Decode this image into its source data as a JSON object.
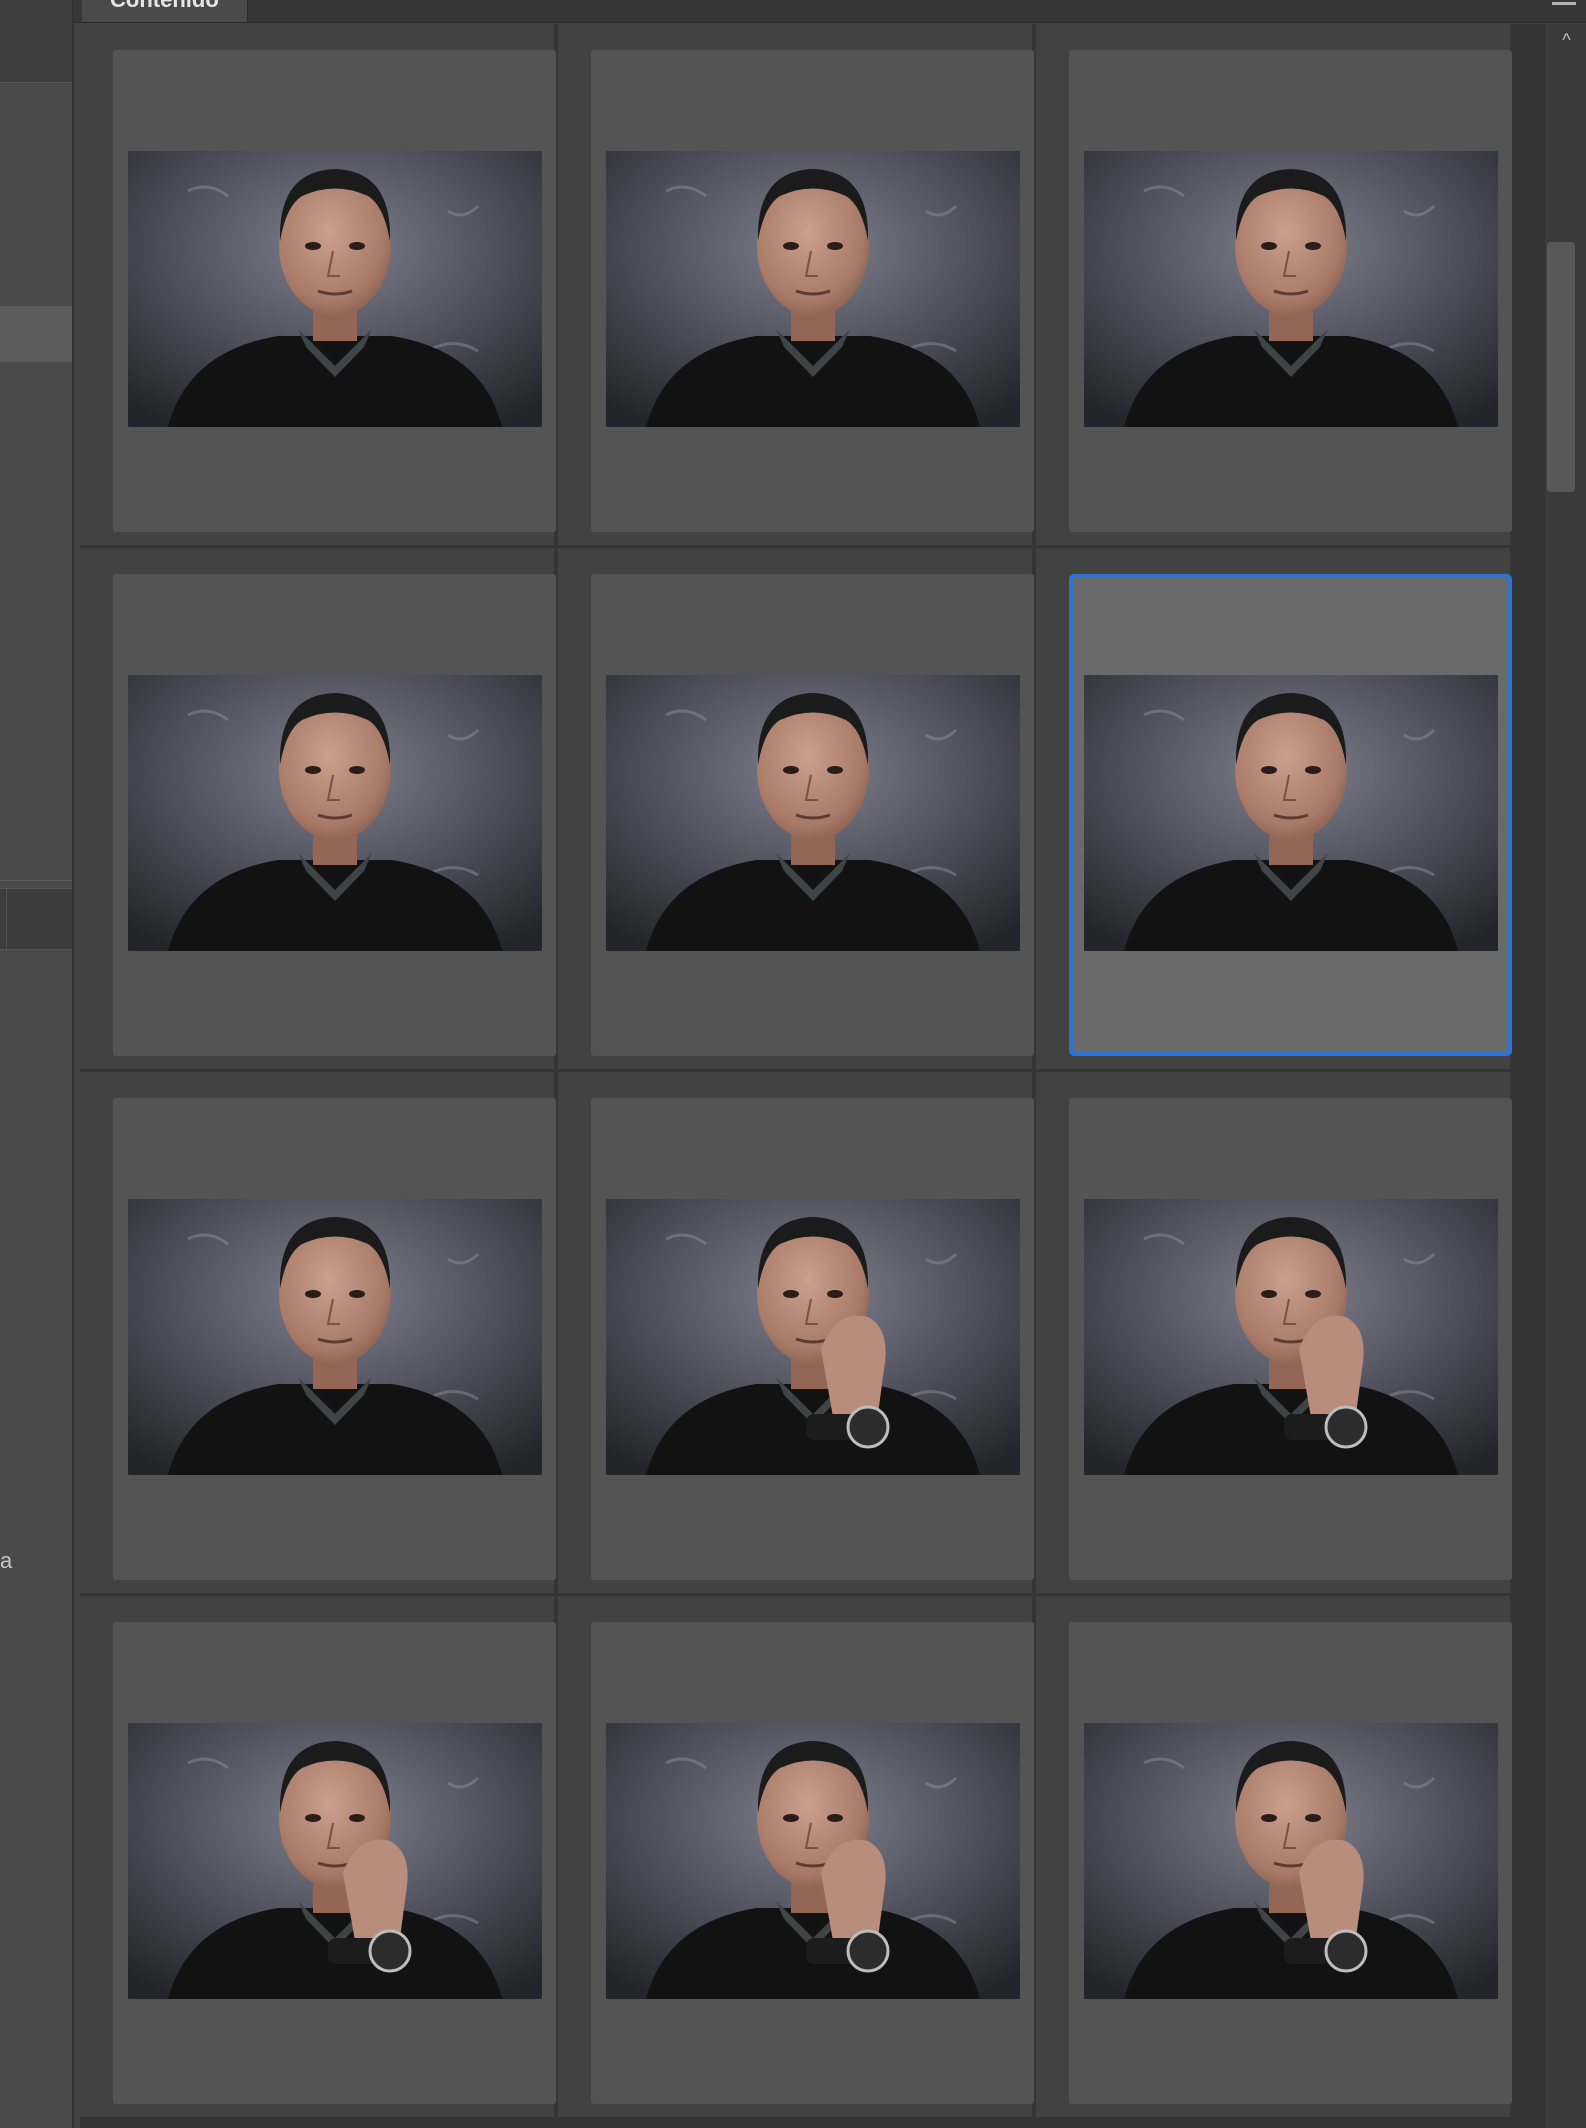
{
  "content_panel": {
    "tab_label": "Contenido"
  },
  "left_panel": {
    "partial_label": "a"
  },
  "scrollbar": {
    "up_arrow": "^"
  },
  "thumbnails": [
    {
      "pose": "neutral",
      "selected": false
    },
    {
      "pose": "neutral",
      "selected": false
    },
    {
      "pose": "neutral",
      "selected": false
    },
    {
      "pose": "neutral",
      "selected": false
    },
    {
      "pose": "neutral",
      "selected": false
    },
    {
      "pose": "neutral",
      "selected": true
    },
    {
      "pose": "neutral",
      "selected": false
    },
    {
      "pose": "hand-on-chin",
      "selected": false
    },
    {
      "pose": "hand-on-chin",
      "selected": false
    },
    {
      "pose": "hand-on-chin",
      "selected": false
    },
    {
      "pose": "hand-on-chin",
      "selected": false
    },
    {
      "pose": "hand-on-chin",
      "selected": false
    }
  ],
  "colors": {
    "selection_border": "#2a74d6",
    "panel_bg": "#424242",
    "card_bg": "#545454"
  }
}
